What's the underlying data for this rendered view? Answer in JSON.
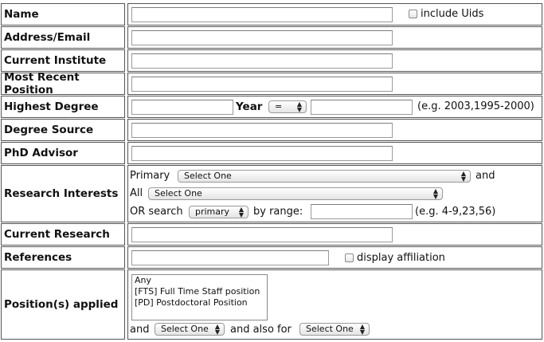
{
  "form": {
    "name": {
      "label": "Name",
      "value": "",
      "checkbox_label": "include Uids"
    },
    "address": {
      "label": "Address/Email",
      "value": ""
    },
    "institute": {
      "label": "Current Institute",
      "value": ""
    },
    "position": {
      "label": "Most Recent Position",
      "value": ""
    },
    "degree": {
      "label": "Highest Degree",
      "value": "",
      "year_label": "Year",
      "year_op": "=",
      "year_value": "",
      "year_hint": "(e.g. 2003,1995-2000)"
    },
    "degree_source": {
      "label": "Degree Source",
      "value": ""
    },
    "advisor": {
      "label": "PhD Advisor",
      "value": ""
    },
    "research": {
      "label": "Research Interests",
      "primary_label": "Primary",
      "primary_select": "Select One",
      "and_label": "and",
      "all_label": "All",
      "all_select": "Select One",
      "search_label": "OR search",
      "search_select": "primary",
      "range_label": "by range:",
      "range_value": "",
      "range_hint": "(e.g. 4-9,23,56)"
    },
    "current_research": {
      "label": "Current Research",
      "value": ""
    },
    "references": {
      "label": "References",
      "value": "",
      "checkbox_label": "display affiliation"
    },
    "positions": {
      "label": "Position(s) applied",
      "options": [
        "Any",
        "[FTS] Full Time Staff position",
        "[PD] Postdoctoral Position"
      ],
      "and_label": "and",
      "and_select": "Select One",
      "also_label": "and also for",
      "also_select": "Select One"
    }
  },
  "icons": {
    "select_arrow": "updown-arrow-icon",
    "checkbox": "checkbox-icon"
  }
}
